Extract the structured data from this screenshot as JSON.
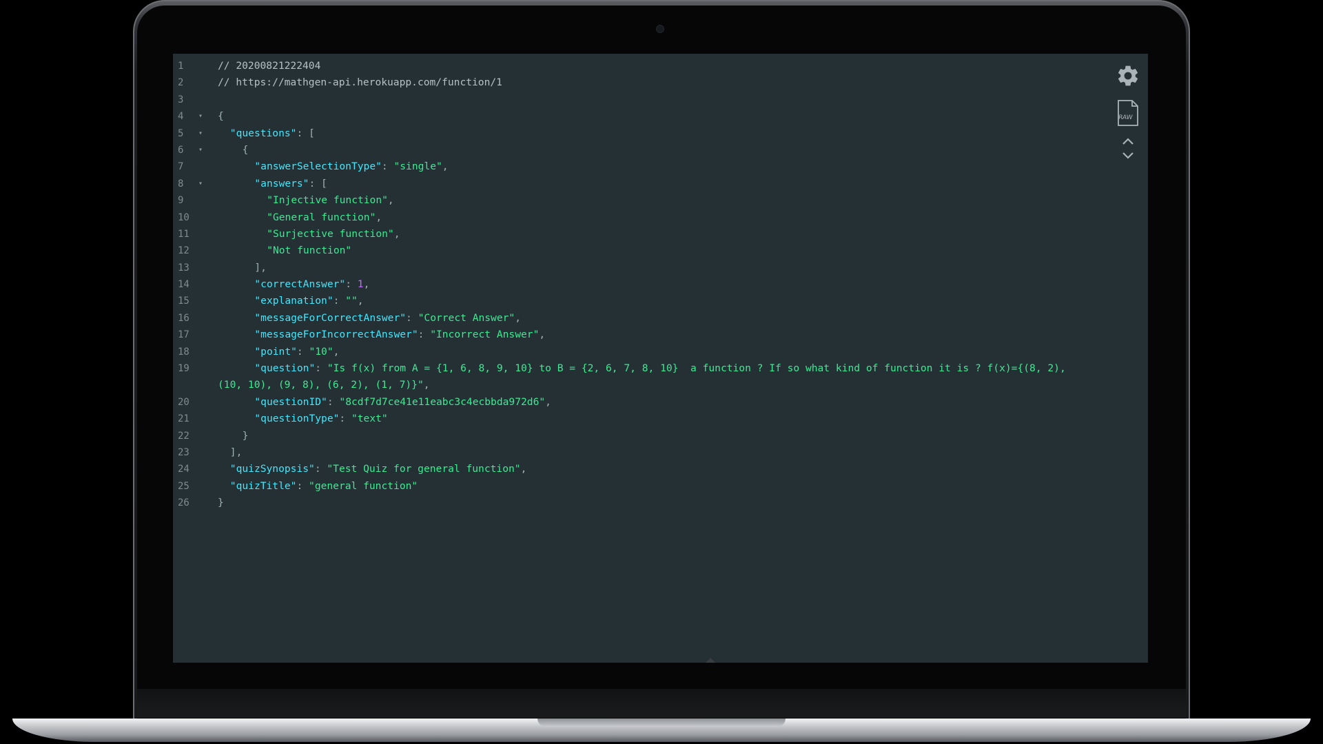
{
  "editor": {
    "lines": [
      {
        "n": "1",
        "fold": false,
        "indent": 0,
        "tokens": [
          [
            "c-comment",
            "// 20200821222404"
          ]
        ]
      },
      {
        "n": "2",
        "fold": false,
        "indent": 0,
        "tokens": [
          [
            "c-comment",
            "// https://mathgen-api.herokuapp.com/function/1"
          ]
        ]
      },
      {
        "n": "3",
        "fold": false,
        "indent": 0,
        "tokens": []
      },
      {
        "n": "4",
        "fold": true,
        "indent": 0,
        "tokens": [
          [
            "c-punc",
            "{"
          ]
        ]
      },
      {
        "n": "5",
        "fold": true,
        "indent": 1,
        "tokens": [
          [
            "c-key",
            "\"questions\""
          ],
          [
            "c-punc",
            ": ["
          ]
        ]
      },
      {
        "n": "6",
        "fold": true,
        "indent": 2,
        "tokens": [
          [
            "c-punc",
            "{"
          ]
        ]
      },
      {
        "n": "7",
        "fold": false,
        "indent": 3,
        "tokens": [
          [
            "c-key",
            "\"answerSelectionType\""
          ],
          [
            "c-punc",
            ": "
          ],
          [
            "c-str",
            "\"single\""
          ],
          [
            "c-punc",
            ","
          ]
        ]
      },
      {
        "n": "8",
        "fold": true,
        "indent": 3,
        "tokens": [
          [
            "c-key",
            "\"answers\""
          ],
          [
            "c-punc",
            ": ["
          ]
        ]
      },
      {
        "n": "9",
        "fold": false,
        "indent": 4,
        "tokens": [
          [
            "c-str",
            "\"Injective function\""
          ],
          [
            "c-punc",
            ","
          ]
        ]
      },
      {
        "n": "10",
        "fold": false,
        "indent": 4,
        "tokens": [
          [
            "c-str",
            "\"General function\""
          ],
          [
            "c-punc",
            ","
          ]
        ]
      },
      {
        "n": "11",
        "fold": false,
        "indent": 4,
        "tokens": [
          [
            "c-str",
            "\"Surjective function\""
          ],
          [
            "c-punc",
            ","
          ]
        ]
      },
      {
        "n": "12",
        "fold": false,
        "indent": 4,
        "tokens": [
          [
            "c-str",
            "\"Not function\""
          ]
        ]
      },
      {
        "n": "13",
        "fold": false,
        "indent": 3,
        "tokens": [
          [
            "c-punc",
            "],"
          ]
        ]
      },
      {
        "n": "14",
        "fold": false,
        "indent": 3,
        "tokens": [
          [
            "c-key",
            "\"correctAnswer\""
          ],
          [
            "c-punc",
            ": "
          ],
          [
            "c-num",
            "1"
          ],
          [
            "c-punc",
            ","
          ]
        ]
      },
      {
        "n": "15",
        "fold": false,
        "indent": 3,
        "tokens": [
          [
            "c-key",
            "\"explanation\""
          ],
          [
            "c-punc",
            ": "
          ],
          [
            "c-str",
            "\"\""
          ],
          [
            "c-punc",
            ","
          ]
        ]
      },
      {
        "n": "16",
        "fold": false,
        "indent": 3,
        "tokens": [
          [
            "c-key",
            "\"messageForCorrectAnswer\""
          ],
          [
            "c-punc",
            ": "
          ],
          [
            "c-str",
            "\"Correct Answer\""
          ],
          [
            "c-punc",
            ","
          ]
        ]
      },
      {
        "n": "17",
        "fold": false,
        "indent": 3,
        "tokens": [
          [
            "c-key",
            "\"messageForIncorrectAnswer\""
          ],
          [
            "c-punc",
            ": "
          ],
          [
            "c-str",
            "\"Incorrect Answer\""
          ],
          [
            "c-punc",
            ","
          ]
        ]
      },
      {
        "n": "18",
        "fold": false,
        "indent": 3,
        "tokens": [
          [
            "c-key",
            "\"point\""
          ],
          [
            "c-punc",
            ": "
          ],
          [
            "c-str",
            "\"10\""
          ],
          [
            "c-punc",
            ","
          ]
        ]
      },
      {
        "n": "19",
        "fold": false,
        "indent": 3,
        "tokens": [
          [
            "c-key",
            "\"question\""
          ],
          [
            "c-punc",
            ": "
          ],
          [
            "c-str",
            "\"Is f(x) from A = {1, 6, 8, 9, 10} to B = {2, 6, 7, 8, 10}  a function ? If so what kind of function it is ? f(x)={(8, 2),"
          ]
        ],
        "continuation": [
          [
            "c-str",
            "(10, 10), (9, 8), (6, 2), (1, 7)}\""
          ],
          [
            "c-punc",
            ","
          ]
        ]
      },
      {
        "n": "20",
        "fold": false,
        "indent": 3,
        "tokens": [
          [
            "c-key",
            "\"questionID\""
          ],
          [
            "c-punc",
            ": "
          ],
          [
            "c-str",
            "\"8cdf7d7ce41e11eabc3c4ecbbda972d6\""
          ],
          [
            "c-punc",
            ","
          ]
        ]
      },
      {
        "n": "21",
        "fold": false,
        "indent": 3,
        "tokens": [
          [
            "c-key",
            "\"questionType\""
          ],
          [
            "c-punc",
            ": "
          ],
          [
            "c-str",
            "\"text\""
          ]
        ]
      },
      {
        "n": "22",
        "fold": false,
        "indent": 2,
        "tokens": [
          [
            "c-punc",
            "}"
          ]
        ]
      },
      {
        "n": "23",
        "fold": false,
        "indent": 1,
        "tokens": [
          [
            "c-punc",
            "],"
          ]
        ]
      },
      {
        "n": "24",
        "fold": false,
        "indent": 1,
        "tokens": [
          [
            "c-key",
            "\"quizSynopsis\""
          ],
          [
            "c-punc",
            ": "
          ],
          [
            "c-str",
            "\"Test Quiz for general function\""
          ],
          [
            "c-punc",
            ","
          ]
        ]
      },
      {
        "n": "25",
        "fold": false,
        "indent": 1,
        "tokens": [
          [
            "c-key",
            "\"quizTitle\""
          ],
          [
            "c-punc",
            ": "
          ],
          [
            "c-str",
            "\"general function\""
          ]
        ]
      },
      {
        "n": "26",
        "fold": false,
        "indent": 0,
        "tokens": [
          [
            "c-punc",
            "}"
          ]
        ]
      }
    ]
  },
  "toolbar": {
    "settings_icon": "gear-icon",
    "raw_icon": "raw-file-icon",
    "raw_label": "RAW",
    "collapse_icon": "chevron-up-icon",
    "expand_icon": "chevron-down-icon"
  },
  "colors": {
    "background": "#253035",
    "key": "#43e6fb",
    "string": "#3dea92",
    "number": "#c46cff",
    "comment": "#b6c1c4"
  }
}
